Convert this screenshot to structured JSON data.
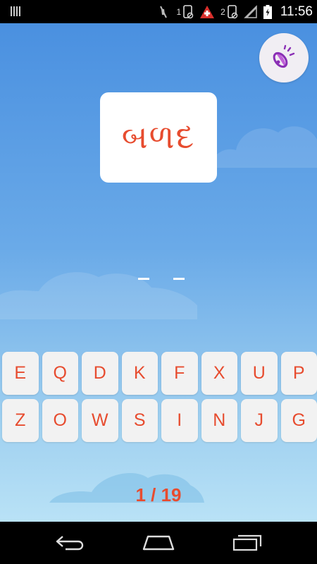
{
  "status_bar": {
    "time": "11:56",
    "sim1_label": "1",
    "sim2_label": "2",
    "icons": [
      "notification-icon",
      "mute-icon",
      "sim1-icon",
      "alert-icon",
      "sim2-icon",
      "signal-icon",
      "battery-icon"
    ]
  },
  "game": {
    "word": "બળદ",
    "answer_slots": 2,
    "progress": "1 / 19",
    "accent_color": "#e74c2f"
  },
  "keyboard": {
    "row1": [
      "E",
      "Q",
      "D",
      "K",
      "F",
      "X",
      "U",
      "P"
    ],
    "row2": [
      "Z",
      "O",
      "W",
      "S",
      "I",
      "N",
      "J",
      "G"
    ]
  },
  "nav_bar": {
    "icons": [
      "back-icon",
      "home-icon",
      "recent-apps-icon"
    ]
  }
}
